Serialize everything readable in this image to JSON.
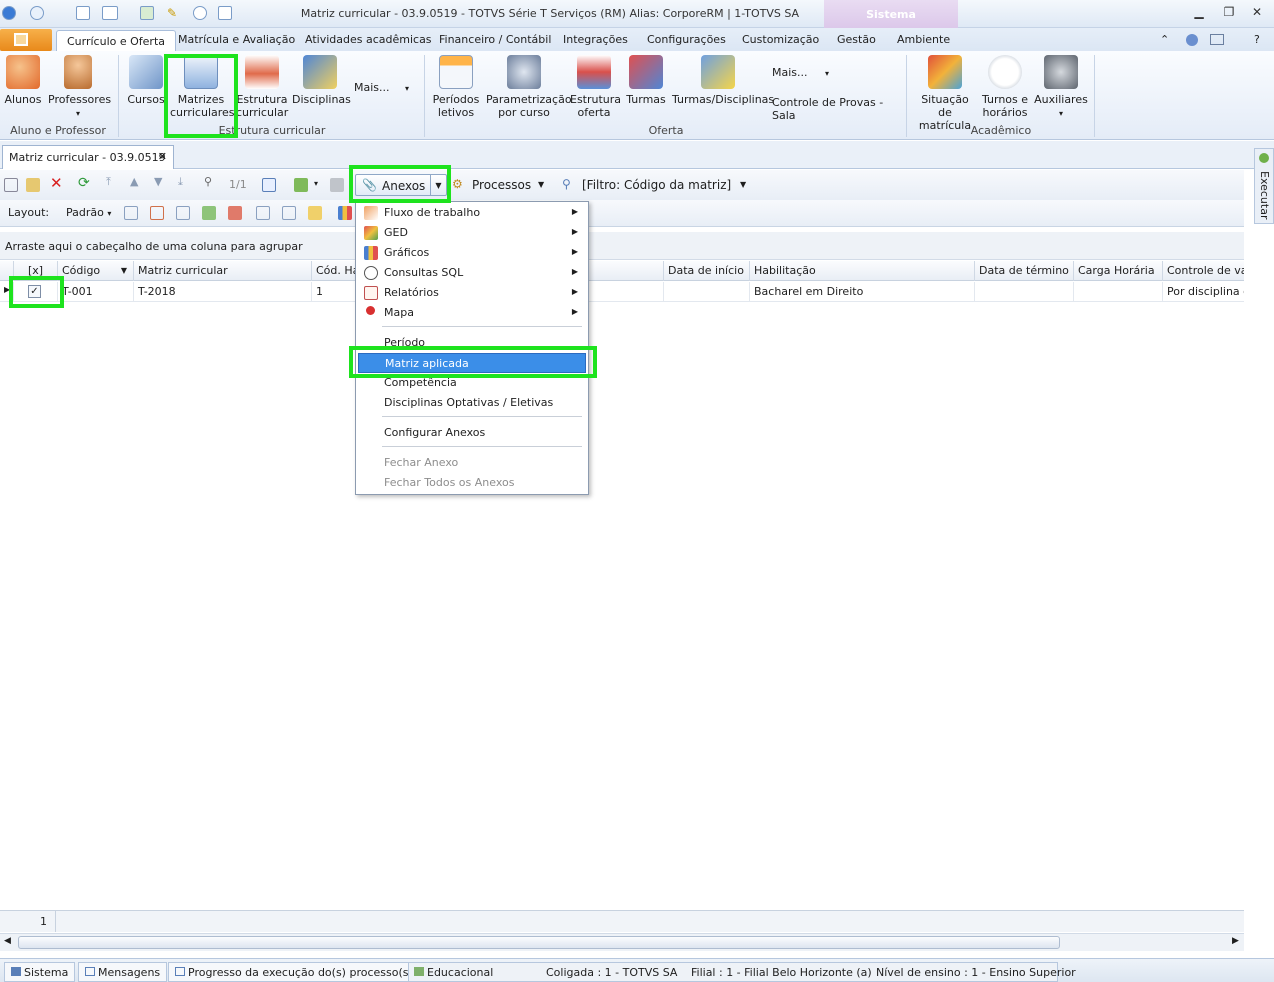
{
  "window": {
    "title": "Matriz curricular - 03.9.0519 - TOTVS Série T Serviços (RM) Alias: CorporeRM | 1-TOTVS SA",
    "sistema_tab": "Sistema"
  },
  "ribbon_tabs": [
    "Currículo e Oferta",
    "Matrícula e Avaliação",
    "Atividades acadêmicas",
    "Financeiro / Contábil",
    "Integrações",
    "Configurações",
    "Customização",
    "Gestão",
    "Ambiente"
  ],
  "ribbon": {
    "aluno_prof": {
      "label": "Aluno e Professor",
      "alunos": "Alunos",
      "professores": "Professores"
    },
    "estrutura": {
      "label": "Estrutura curricular",
      "cursos": "Cursos",
      "matrizes_1": "Matrizes",
      "matrizes_2": "curriculares",
      "estrutura_1": "Estrutura",
      "estrutura_2": "curricular",
      "disciplinas": "Disciplinas",
      "mais": "Mais..."
    },
    "oferta": {
      "label": "Oferta",
      "periodos_1": "Períodos",
      "periodos_2": "letivos",
      "param_1": "Parametrização",
      "param_2": "por curso",
      "estrut_oferta_1": "Estrutura",
      "estrut_oferta_2": "oferta",
      "turmas": "Turmas",
      "turmas_disc": "Turmas/Disciplinas",
      "mais": "Mais...",
      "controle": "Controle de Provas - Sala"
    },
    "academico": {
      "label": "Acadêmico",
      "situacao_1": "Situação de",
      "situacao_2": "matrícula",
      "turnos_1": "Turnos e",
      "turnos_2": "horários",
      "auxiliares": "Auxiliares"
    }
  },
  "doc_tab": {
    "label": "Matriz curricular - 03.9.0519",
    "close": "✕"
  },
  "toolbar": {
    "page": "1/1",
    "anexos": "Anexos",
    "processos": "Processos",
    "filtro": "[Filtro: Código da matriz]",
    "layout_label": "Layout:",
    "layout_value": "Padrão"
  },
  "groupbar": "Arraste aqui o cabeçalho de uma coluna para agrupar",
  "grid": {
    "headers": [
      "[x]",
      "Código",
      "Matriz curricular",
      "Cód. Ha",
      "Data de início",
      "Habilitação",
      "Data de término",
      "Carga Horária",
      "Controle de vag"
    ],
    "row": {
      "codigo": "T-001",
      "matriz": "T-2018",
      "cod_ha": "1",
      "data_inicio": "",
      "habilitacao": "Bacharel em Direito",
      "data_termino": "",
      "carga": "",
      "controle": "Por disciplina da"
    },
    "footer_count": "1"
  },
  "menu": {
    "items": [
      "Fluxo de trabalho",
      "GED",
      "Gráficos",
      "Consultas SQL",
      "Relatórios",
      "Mapa",
      "Período",
      "Matriz aplicada",
      "Competência",
      "Disciplinas Optativas / Eletivas",
      "Configurar Anexos",
      "Fechar Anexo",
      "Fechar Todos os Anexos"
    ]
  },
  "right_panel": "Executar",
  "status": {
    "sistema": "Sistema",
    "mensagens": "Mensagens",
    "progresso": "Progresso da execução do(s) processo(s)",
    "educacional": "Educacional",
    "coligada": "Coligada : 1 - TOTVS SA",
    "filial": "Filial : 1 - Filial Belo Horizonte (a)",
    "nivel": "Nível de ensino : 1 - Ensino Superior"
  },
  "colors": {
    "highlight": "#1ee31e",
    "menu_selected": "#3b8ee8"
  }
}
